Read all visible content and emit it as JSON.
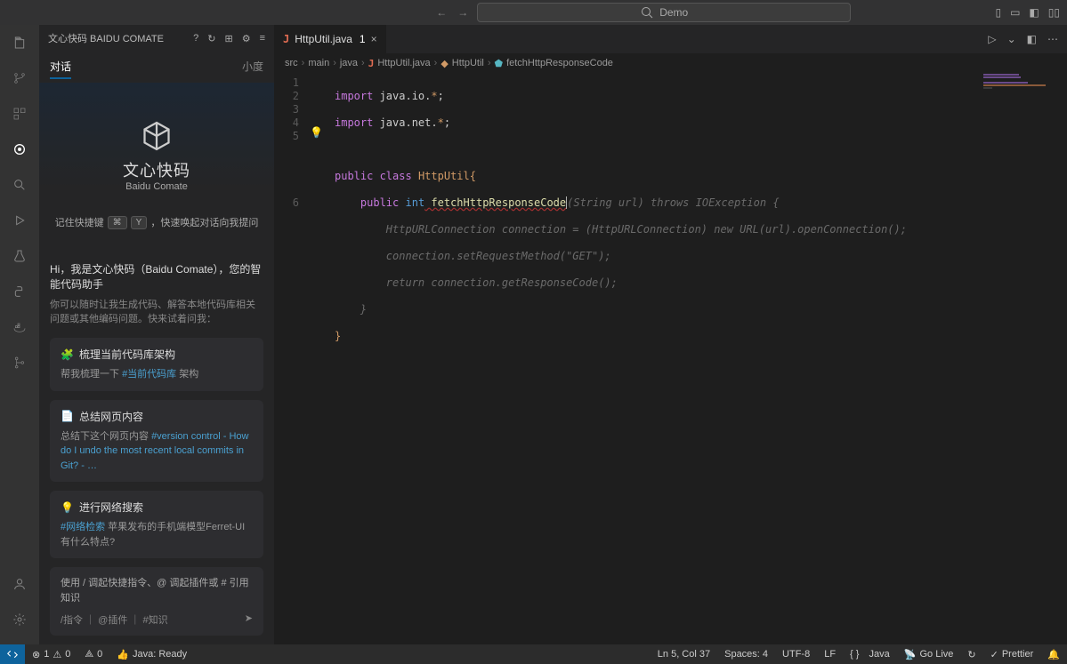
{
  "titleBar": {
    "searchText": "Demo"
  },
  "sidebar": {
    "title": "文心快码 BAIDU COMATE",
    "tabs": {
      "chat": "对话",
      "small": "小度"
    },
    "logo": {
      "text": "文心快码",
      "sub": "Baidu Comate"
    },
    "shortcut": {
      "prefix": "记住快捷键",
      "k1": "⌘",
      "k2": "Y",
      "suffix": "，快速唤起对话向我提问"
    },
    "greeting": "Hi，我是文心快码（Baidu Comate），您的智能代码助手",
    "greetingSub": "你可以随时让我生成代码、解答本地代码库相关问题或其他编码问题。快来试着问我：",
    "sugg1": {
      "title": "梳理当前代码库架构",
      "prefix": "帮我梳理一下 ",
      "link": "#当前代码库",
      "suffix": " 架构"
    },
    "sugg2": {
      "title": "总结网页内容",
      "prefix": "总结下这个网页内容 ",
      "link": "#version control - How do I undo the most recent local commits in Git? - …"
    },
    "sugg3": {
      "title": "进行网络搜索",
      "link": "#网络检索",
      "suffix": " 苹果发布的手机端模型Ferret-UI有什么特点?"
    },
    "input": {
      "hint": "使用 / 调起快捷指令、@ 调起插件或 # 引用知识",
      "tags": "/指令 ｜ @插件 ｜ #知识"
    }
  },
  "editor": {
    "tab": {
      "name": "HttpUtil.java",
      "dirty": "1"
    },
    "breadcrumbs": {
      "p0": "src",
      "p1": "main",
      "p2": "java",
      "p3": "HttpUtil.java",
      "p4": "HttpUtil",
      "p5": "fetchHttpResponseCode"
    },
    "code": {
      "l1a": "import",
      "l1b": " java.io.",
      "l1c": "*",
      "l1d": ";",
      "l2a": "import",
      "l2b": " java.net.",
      "l2c": "*",
      "l2d": ";",
      "l4a": "public",
      "l4b": " class",
      "l4c": " HttpUtil",
      "l4d": "{",
      "l5a": "public",
      "l5b": " int",
      "l5c": " fetchHttpResponseCode",
      "l5g": "(String url) throws IOException {",
      "g1": "        HttpURLConnection connection = (HttpURLConnection) new URL(url).openConnection();",
      "g2": "        connection.setRequestMethod(\"GET\");",
      "g3": "        return connection.getResponseCode();",
      "g4": "    }",
      "l6": "}"
    }
  },
  "status": {
    "errors": "1",
    "warnings": "0",
    "ports": "0",
    "java": "Java: Ready",
    "pos": "Ln 5, Col 37",
    "spaces": "Spaces: 4",
    "enc": "UTF-8",
    "eol": "LF",
    "lang": "Java",
    "golive": "Go Live",
    "prettier": "Prettier"
  }
}
